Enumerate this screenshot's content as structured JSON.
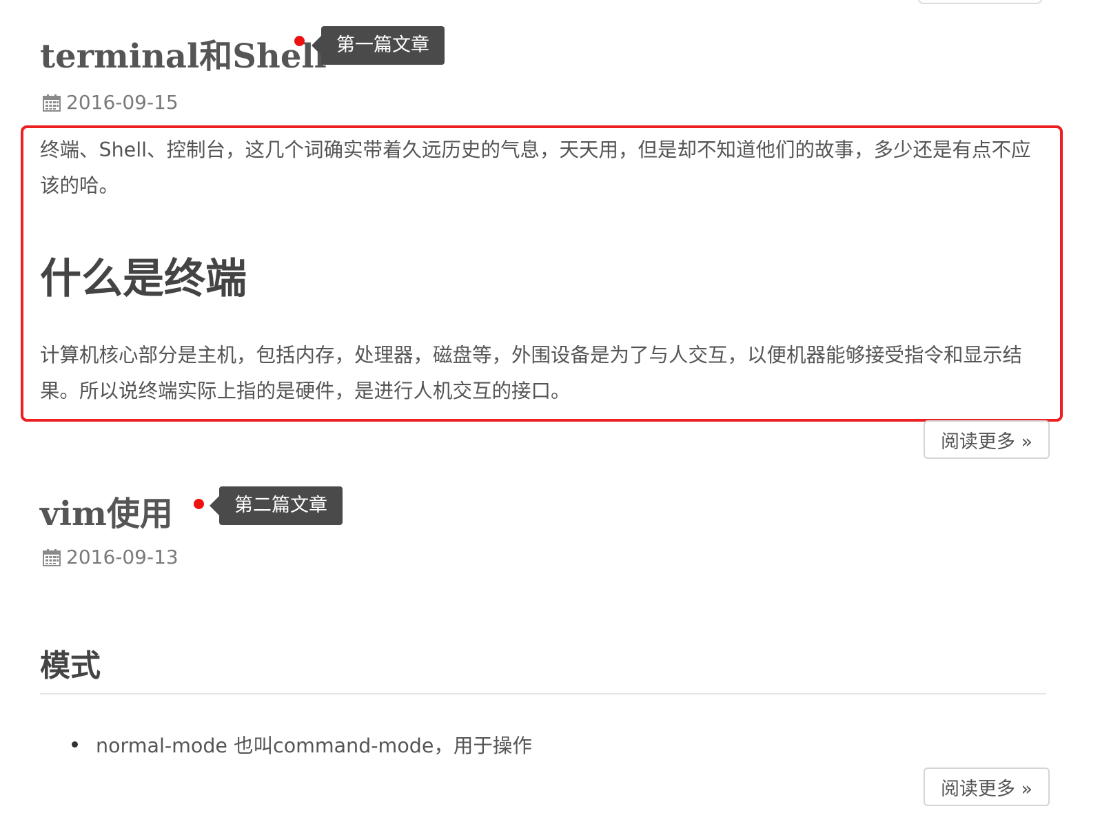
{
  "posts": [
    {
      "title": "terminal和Shell",
      "tag": "第一篇文章",
      "date": "2016-09-15",
      "intro": "终端、Shell、控制台，这几个词确实带着久远历史的气息，天天用，但是却不知道他们的故事，多少还是有点不应该的哈。",
      "heading": "什么是终端",
      "body": "计算机核心部分是主机，包括内存，处理器，磁盘等，外围设备是为了与人交互，以便机器能够接受指令和显示结果。所以说终端实际上指的是硬件，是进行人机交互的接口。",
      "read_more": "阅读更多 »"
    },
    {
      "title": "vim使用",
      "tag": "第二篇文章",
      "date": "2016-09-13",
      "heading": "模式",
      "bullets": [
        "normal-mode 也叫command-mode，用于操作"
      ],
      "read_more": "阅读更多 »"
    }
  ],
  "colors": {
    "highlight_border": "#ec2020",
    "tag_bg": "#4a4a4a",
    "red_dot": "#ee1111"
  },
  "icons": {
    "date": "calendar-icon"
  }
}
